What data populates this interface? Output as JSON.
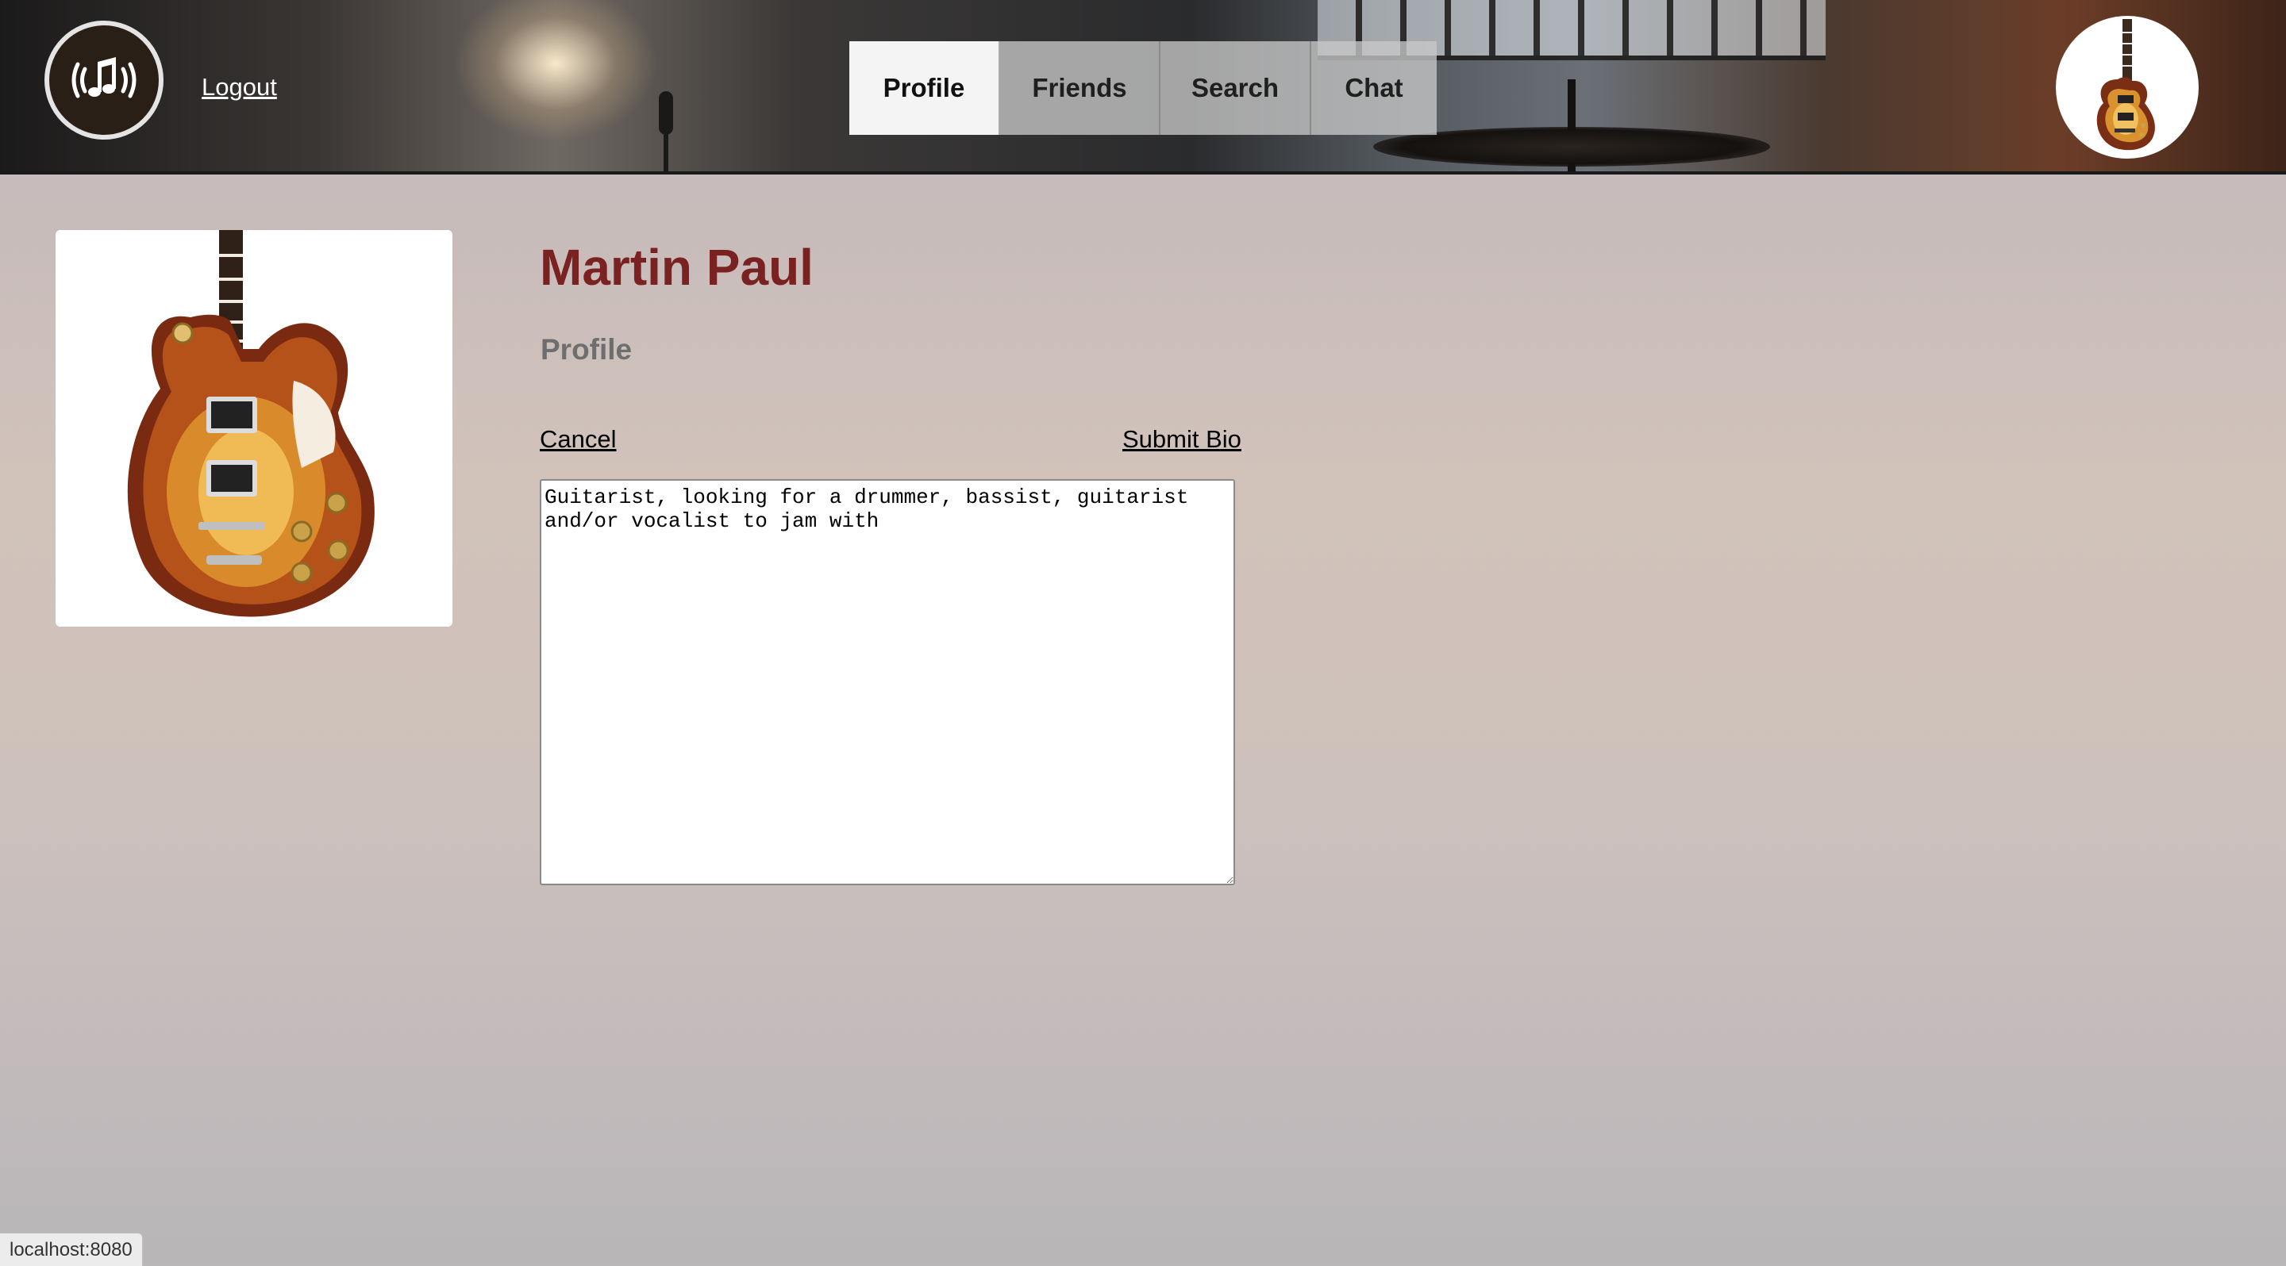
{
  "header": {
    "logo_icon": "music-note-broadcast-icon",
    "logout_label": "Logout",
    "nav": {
      "tabs": [
        {
          "label": "Profile",
          "active": true
        },
        {
          "label": "Friends",
          "active": false
        },
        {
          "label": "Search",
          "active": false
        },
        {
          "label": "Chat",
          "active": false
        }
      ]
    },
    "avatar_icon": "guitar-icon"
  },
  "profile": {
    "photo_icon": "electric-guitar-image",
    "name": "Martin Paul",
    "section_title": "Profile",
    "cancel_label": "Cancel",
    "submit_label": "Submit Bio",
    "bio_text": "Guitarist, looking for a drummer, bassist, guitarist and/or vocalist to jam with"
  },
  "status_bar": {
    "url": "localhost:8080"
  },
  "colors": {
    "name_color": "#7a2222",
    "active_tab_bg": "#f4f4f4",
    "tab_bg": "#c8c8c8"
  }
}
